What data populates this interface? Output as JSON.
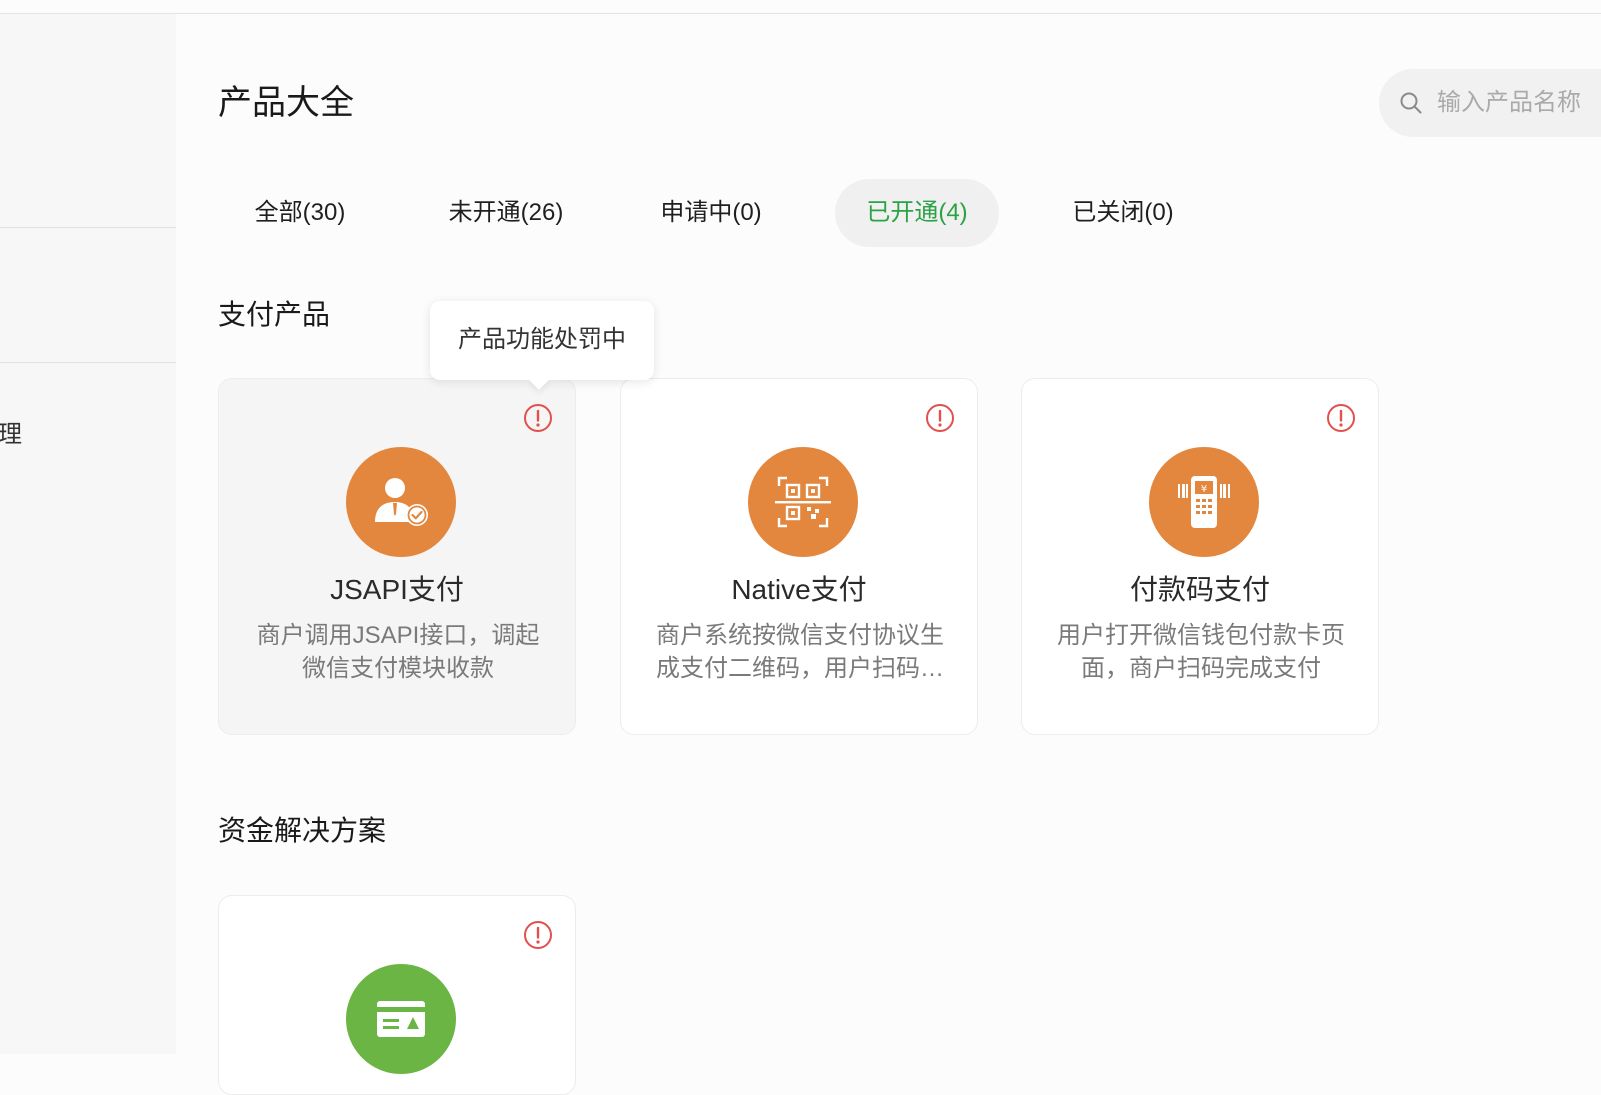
{
  "sidebar": {
    "partial_item_label": "理"
  },
  "page": {
    "title": "产品大全"
  },
  "search": {
    "placeholder": "输入产品名称"
  },
  "tabs": [
    {
      "label": "全部(30)",
      "active": false
    },
    {
      "label": "未开通(26)",
      "active": false
    },
    {
      "label": "申请中(0)",
      "active": false
    },
    {
      "label": "已开通(4)",
      "active": true
    },
    {
      "label": "已关闭(0)",
      "active": false
    }
  ],
  "sections": [
    {
      "title": "支付产品",
      "cards": [
        {
          "title": "JSAPI支付",
          "desc": "商户调用JSAPI接口，调起微信支付模块收款",
          "icon": "user-check-icon"
        },
        {
          "title": "Native支付",
          "desc": "商户系统按微信支付协议生成支付二维码，用户扫码完成支付",
          "icon": "qr-scan-icon"
        },
        {
          "title": "付款码支付",
          "desc": "用户打开微信钱包付款卡页面，商户扫码完成支付",
          "icon": "pos-terminal-icon"
        }
      ]
    },
    {
      "title": "资金解决方案",
      "cards": [
        {
          "title": "",
          "desc": "",
          "icon": "card-account-icon"
        }
      ]
    }
  ],
  "tooltip": {
    "text": "产品功能处罚中"
  },
  "colors": {
    "accent_green": "#2ba245",
    "payment_icon_orange": "#e3873f",
    "fund_icon_green": "#6ab543",
    "alert_red": "#e2504e"
  }
}
